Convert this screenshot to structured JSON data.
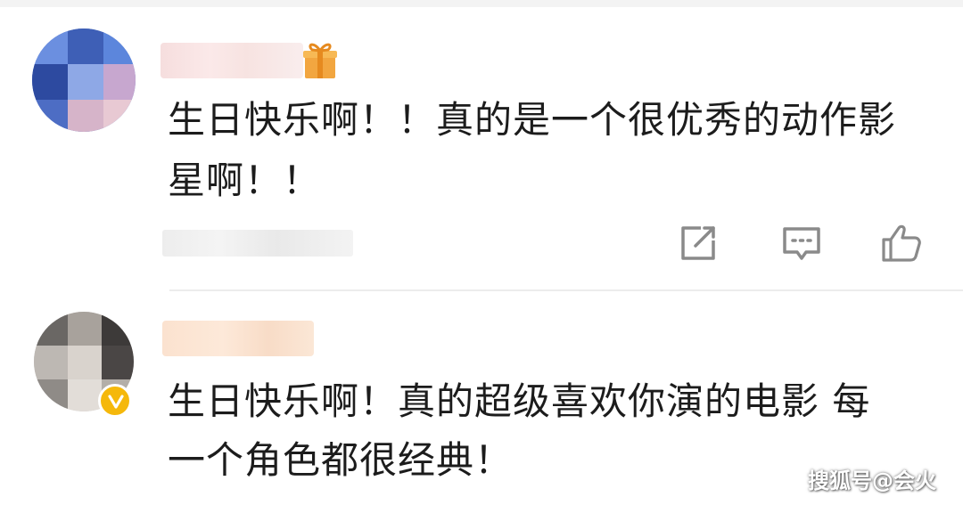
{
  "comments": [
    {
      "text_lines": [
        "生日快乐啊！！真的是一个很优秀的动作影",
        "星啊！！"
      ],
      "actions": {
        "share_icon": "share-icon",
        "reply_icon": "comment-icon",
        "like_icon": "thumbs-up-icon"
      }
    },
    {
      "text_lines": [
        "生日快乐啊！真的超级喜欢你演的电影 每",
        "一个角色都很经典！"
      ],
      "verified": true
    }
  ],
  "watermark": "搜狐号@会火",
  "colors": {
    "text": "#1c1c1c",
    "icon": "#8a8a8a",
    "verified_badge": "#f5b80b",
    "gift": "#f0a43a"
  }
}
